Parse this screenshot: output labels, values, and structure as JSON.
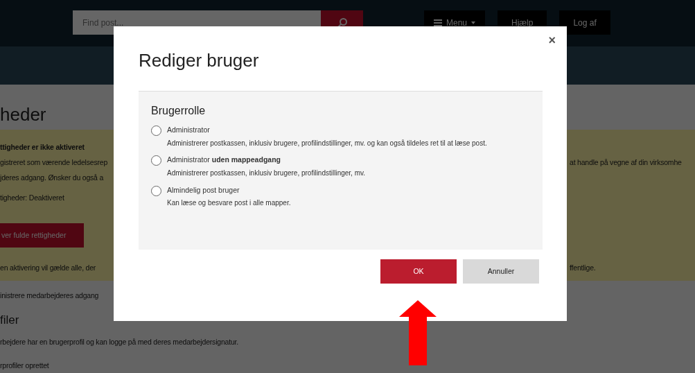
{
  "header": {
    "search": {
      "placeholder": "Find post..."
    },
    "nav": [
      {
        "label": "Menu",
        "kind": "menu"
      },
      {
        "label": "Hjælp",
        "kind": "plain"
      },
      {
        "label": "Log af",
        "kind": "plain"
      }
    ]
  },
  "page": {
    "heading": "heder",
    "notice": {
      "title": "ttigheder er ikke aktiveret",
      "lines": [
        {
          "left": "gistreret som værende ledelsesrep",
          "right": "at handle på vegne af din virksomhe"
        },
        {
          "left": "jderes adgang. Ønsker du også a"
        }
      ],
      "status": "tigheder: Deaktiveret",
      "button": "ver fulde rettigheder",
      "footer": {
        "left": "en aktivering vil gælde alle, der",
        "right": "ffentlige."
      }
    },
    "admin_text": "inistrere medarbejderes adgang",
    "section_heading": "filer",
    "section_text": "rbejdere har en brugerprofil og kan logge på med deres medarbejdersignatur.",
    "section_status": "rprofiler oprettet"
  },
  "dialog": {
    "title": "Rediger bruger",
    "close": "×",
    "fieldset": "Brugerrolle",
    "roles": [
      {
        "label": "Administrator",
        "description": "Administrerer postkassen, inklusiv brugere, profilindstillinger, mv. og kan også tildeles ret til at læse post.",
        "selected": false
      },
      {
        "label": "Administrator **uden mappeadgang**",
        "description": "Administrerer postkassen, inklusiv brugere, profilindstillinger, mv.",
        "selected": false
      },
      {
        "label": "Almindelig post bruger",
        "description": "Kan læse og besvare post i alle mapper.",
        "selected": false
      }
    ],
    "buttons": [
      {
        "label": "OK",
        "kind": "primary"
      },
      {
        "label": "Annuller",
        "kind": "secondary"
      }
    ]
  }
}
